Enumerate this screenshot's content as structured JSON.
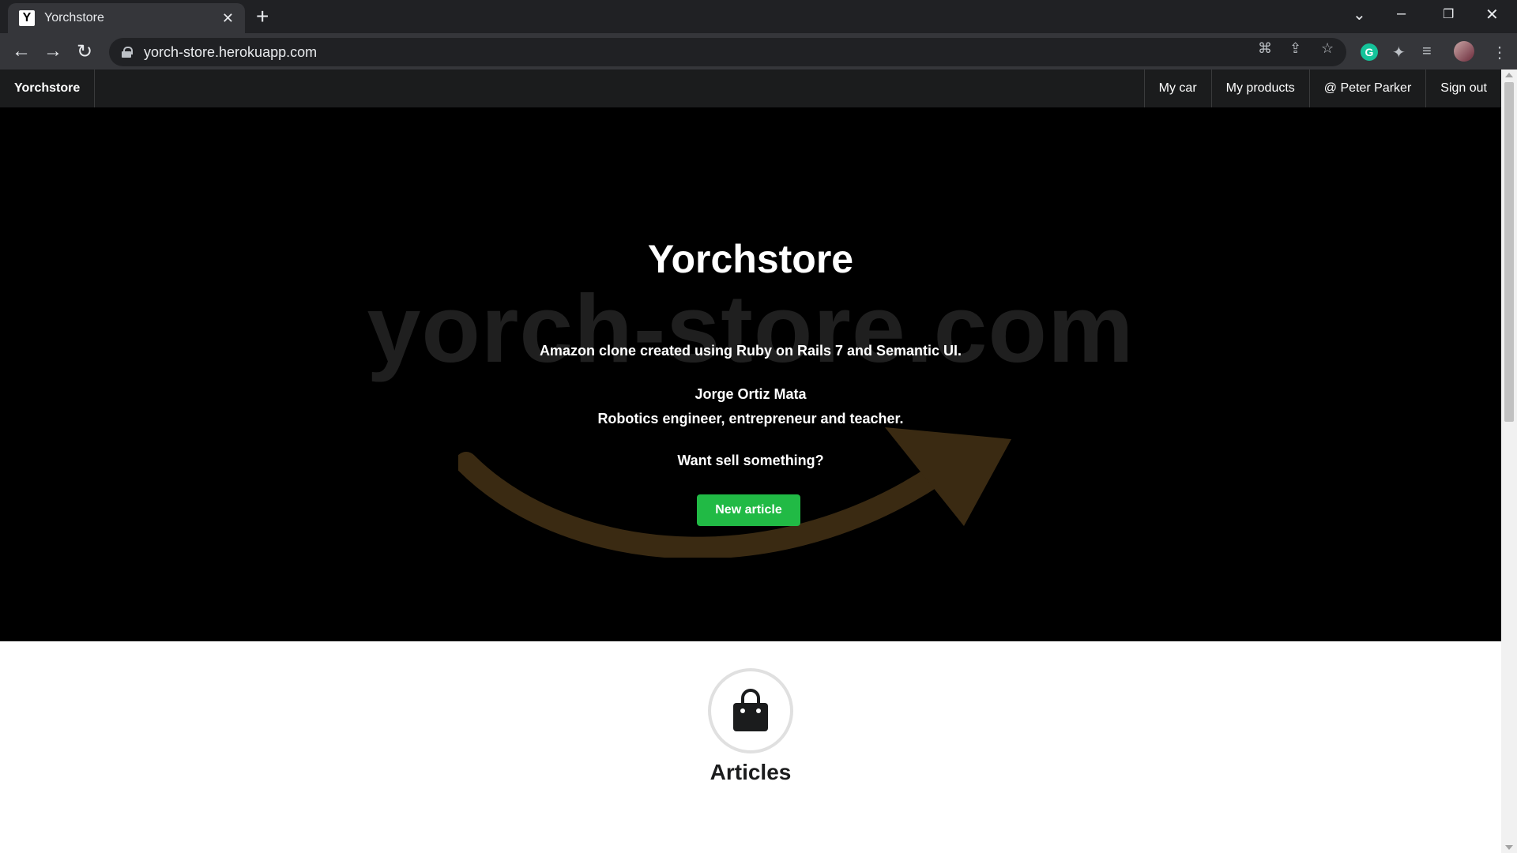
{
  "browser": {
    "tab_title": "Yorchstore",
    "favicon_letter": "Y",
    "url": "yorch-store.herokuapp.com"
  },
  "nav": {
    "brand": "Yorchstore",
    "items": [
      "My car",
      "My products",
      "@ Peter Parker",
      "Sign out"
    ]
  },
  "hero": {
    "title": "Yorchstore",
    "watermark": "yorch-store.com",
    "tagline": "Amazon clone created using Ruby on Rails 7 and Semantic UI.",
    "author": "Jorge Ortiz Mata",
    "role": "Robotics engineer, entrepreneur and teacher.",
    "cta_text": "Want sell something?",
    "cta_button": "New article"
  },
  "articles": {
    "heading": "Articles",
    "icon": "shopping-bag-icon"
  },
  "colors": {
    "nav_bg": "#1b1c1d",
    "hero_bg": "#000000",
    "button_green": "#21ba45",
    "smile_brown": "#3a2a12"
  }
}
